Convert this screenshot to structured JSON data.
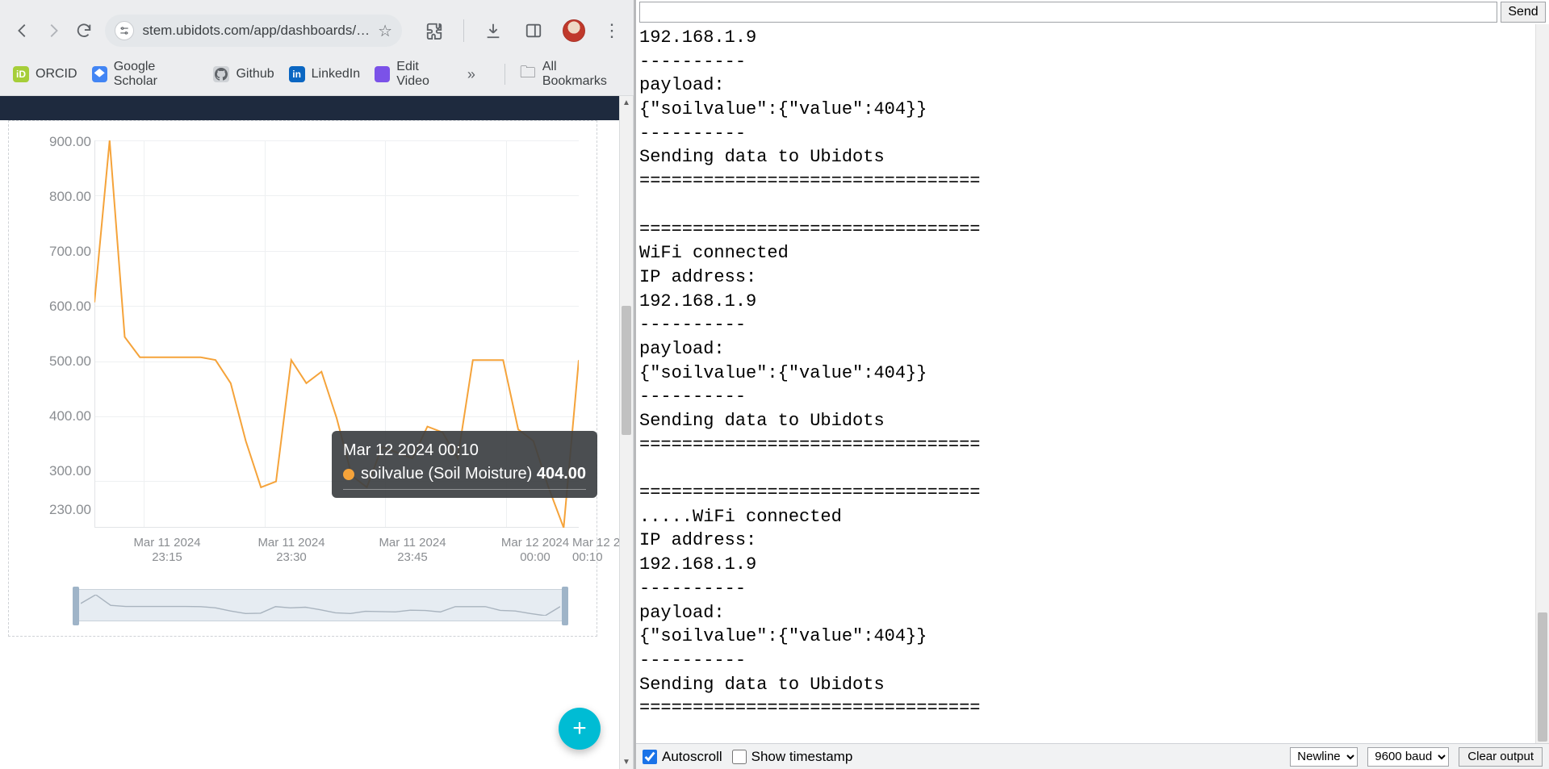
{
  "browser": {
    "url": "stem.ubidots.com/app/dashboards/…",
    "nav": {
      "back": "←",
      "forward": "→",
      "reload": "⟳"
    },
    "bookmarks": [
      {
        "icon": "orcid",
        "label": "ORCID"
      },
      {
        "icon": "gs",
        "label": "Google Scholar"
      },
      {
        "icon": "gh",
        "label": "Github"
      },
      {
        "icon": "li",
        "label": "LinkedIn"
      },
      {
        "icon": "ev",
        "label": "Edit Video"
      }
    ],
    "bookmarks_more": "»",
    "all_bookmarks": "All Bookmarks"
  },
  "chart_data": {
    "type": "line",
    "title": "",
    "xlabel": "",
    "ylabel": "",
    "ylim": [
      230,
      900
    ],
    "y_ticks": [
      230.0,
      300.0,
      400.0,
      500.0,
      600.0,
      700.0,
      800.0,
      900.0
    ],
    "x_ticks": [
      {
        "line1": "Mar 11 2024",
        "line2": "23:15"
      },
      {
        "line1": "Mar 11 2024",
        "line2": "23:30"
      },
      {
        "line1": "Mar 11 2024",
        "line2": "23:45"
      },
      {
        "line1": "Mar 12 2024",
        "line2": "00:00"
      },
      {
        "line1": "Mar 12 2",
        "line2": "00:10"
      }
    ],
    "series": [
      {
        "name": "soilvalue (Soil Moisture)",
        "color": "#f5a33a",
        "x": [
          "23:12",
          "23:13",
          "23:14",
          "23:15",
          "23:16",
          "23:30",
          "23:44",
          "23:45",
          "23:46",
          "23:47",
          "23:48",
          "23:49",
          "23:50",
          "23:51",
          "23:52",
          "23:53",
          "23:54",
          "23:55",
          "23:56",
          "23:57",
          "23:58",
          "23:59",
          "00:00",
          "00:01",
          "00:02",
          "00:03",
          "00:04",
          "00:05",
          "00:06",
          "00:07",
          "00:08",
          "00:09",
          "00:10"
        ],
        "values": [
          620,
          900,
          560,
          525,
          525,
          525,
          525,
          525,
          520,
          480,
          380,
          300,
          310,
          520,
          480,
          500,
          420,
          320,
          300,
          370,
          360,
          350,
          405,
          395,
          350,
          520,
          520,
          520,
          400,
          380,
          300,
          230,
          520
        ]
      }
    ],
    "tooltip": {
      "timestamp": "Mar 12 2024 00:10",
      "series_label": "soilvalue (Soil Moisture)",
      "value": "404.00"
    }
  },
  "fab": "+",
  "serial": {
    "send_label": "Send",
    "input_value": "",
    "log": "192.168.1.9\n----------\npayload:\n{\"soilvalue\":{\"value\":404}}\n----------\nSending data to Ubidots\n================================\n\n================================\nWiFi connected\nIP address:\n192.168.1.9\n----------\npayload:\n{\"soilvalue\":{\"value\":404}}\n----------\nSending data to Ubidots\n================================\n\n================================\n.....WiFi connected\nIP address:\n192.168.1.9\n----------\npayload:\n{\"soilvalue\":{\"value\":404}}\n----------\nSending data to Ubidots\n================================",
    "footer": {
      "autoscroll": "Autoscroll",
      "show_ts": "Show timestamp",
      "line_ending_options": [
        "Newline"
      ],
      "line_ending": "Newline",
      "baud_options": [
        "9600 baud"
      ],
      "baud": "9600 baud",
      "clear": "Clear output"
    }
  }
}
